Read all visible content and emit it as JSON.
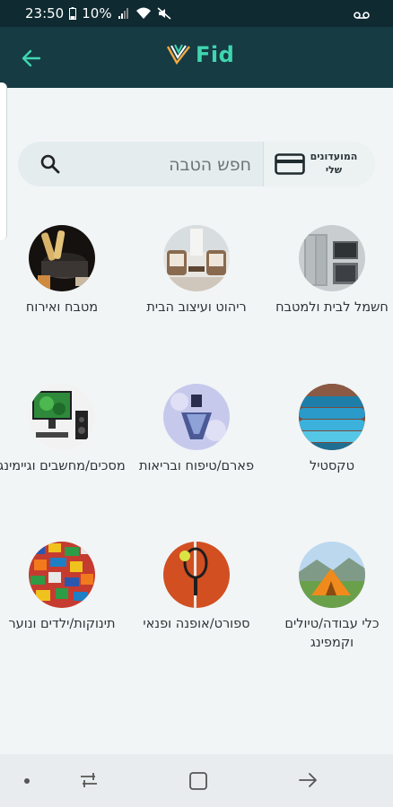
{
  "status_bar": {
    "time": "23:50",
    "battery": "10%"
  },
  "header": {
    "app_name": "Fid",
    "accent_color": "#3fd6b0",
    "background_color": "#163b43"
  },
  "search": {
    "placeholder": "חפש הטבה",
    "clubs_label": "המועדונים שלי"
  },
  "categories": [
    {
      "label": "חשמל לבית ולמטבח",
      "image": "appliances-photo"
    },
    {
      "label": "ריהוט ועיצוב הבית",
      "image": "furniture-photo"
    },
    {
      "label": "מטבח ואירוח",
      "image": "cookware-photo"
    },
    {
      "label": "טקסטיל",
      "image": "towels-photo"
    },
    {
      "label": "פארם/טיפוח ובריאות",
      "image": "perfume-photo"
    },
    {
      "label": "מסכים/מחשבים וגיימינג",
      "image": "computer-photo"
    },
    {
      "label": "כלי עבודה/טיולים וקמפינג",
      "image": "tent-photo"
    },
    {
      "label": "ספורט/אופנה ופנאי",
      "image": "tennis-photo"
    },
    {
      "label": "תינוקות/ילדים ונוער",
      "image": "lego-photo"
    }
  ]
}
